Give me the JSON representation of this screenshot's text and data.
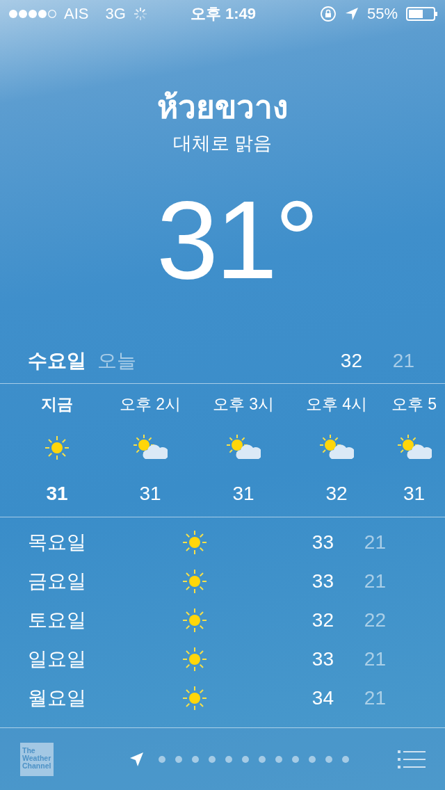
{
  "status_bar": {
    "carrier": "AIS",
    "network": "3G",
    "time": "오후 1:49",
    "battery_text": "55%"
  },
  "location": {
    "city": "ห้วยขวาง",
    "condition": "대체로 맑음",
    "temperature": "31°"
  },
  "today": {
    "day": "수요일",
    "label": "오늘",
    "high": "32",
    "low": "21"
  },
  "hourly": [
    {
      "time": "지금",
      "kind": "sun",
      "temp": "31",
      "current": true
    },
    {
      "time": "오후 2시",
      "kind": "partly_cloudy",
      "temp": "31",
      "current": false
    },
    {
      "time": "오후 3시",
      "kind": "partly_cloudy",
      "temp": "31",
      "current": false
    },
    {
      "time": "오후 4시",
      "kind": "partly_cloudy",
      "temp": "32",
      "current": false
    },
    {
      "time": "오후 5",
      "kind": "partly_cloudy",
      "temp": "31",
      "current": false
    }
  ],
  "daily": [
    {
      "day": "목요일",
      "kind": "sun",
      "high": "33",
      "low": "21"
    },
    {
      "day": "금요일",
      "kind": "sun",
      "high": "33",
      "low": "21"
    },
    {
      "day": "토요일",
      "kind": "sun",
      "high": "32",
      "low": "22"
    },
    {
      "day": "일요일",
      "kind": "sun",
      "high": "33",
      "low": "21"
    },
    {
      "day": "월요일",
      "kind": "sun",
      "high": "34",
      "low": "21"
    }
  ],
  "bottom_bar": {
    "logo": "The Weather Channel",
    "pages": [
      {
        "kind": "location",
        "selected": true
      },
      {
        "kind": "dot",
        "selected": false
      },
      {
        "kind": "dot",
        "selected": false
      },
      {
        "kind": "dot",
        "selected": false
      },
      {
        "kind": "dot",
        "selected": false
      },
      {
        "kind": "dot",
        "selected": false
      },
      {
        "kind": "dot",
        "selected": false
      },
      {
        "kind": "dot",
        "selected": false
      },
      {
        "kind": "dot",
        "selected": false
      },
      {
        "kind": "dot",
        "selected": false
      },
      {
        "kind": "dot",
        "selected": false
      },
      {
        "kind": "dot",
        "selected": false
      },
      {
        "kind": "dot",
        "selected": false
      }
    ]
  }
}
